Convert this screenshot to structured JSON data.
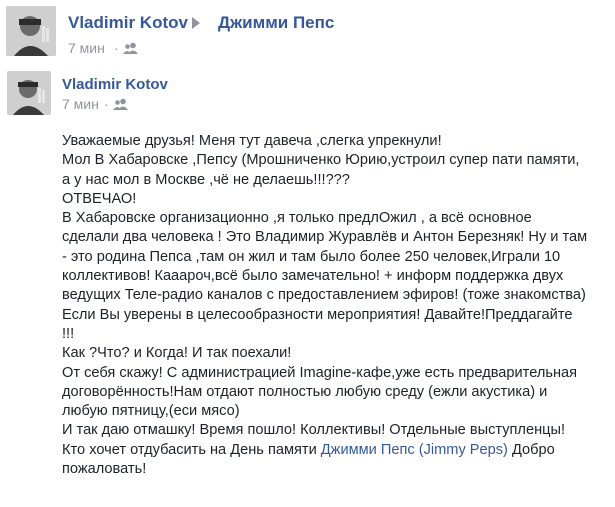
{
  "header": {
    "author": "Vladimir Kotov",
    "group": "Джимми Пепс",
    "time": "7 мин",
    "separator": "·"
  },
  "post": {
    "author": "Vladimir Kotov",
    "time": "7 мин",
    "separator": "·",
    "lines": [
      "Уважаемые друзья! Меня тут давеча ,слегка упрекнули!",
      "Мол В Хабаровске ,Пепсу (Мрошниченко Юрию,устроил супер пати памяти,",
      "а у нас мол в Москве ,чё не делаешь!!!???",
      "ОТВЕЧАО!",
      "В Хабаровске организационно ,я только предлОжил , а всё основное",
      "сделали два человека ! Это Владимир Журавлёв и Антон Березняк! Ну и там",
      "- это родина Пепса ,там он жил и там было более 250 человек,Играли 10",
      "коллективов! Кааароч,всё было замечательно! + информ поддержка двух",
      "ведущих Теле-радио каналов с предоставлением эфиров! (тоже знакомства)",
      "Если Вы уверены в целесообразности мероприятия! Давайте!Преддагайте",
      "!!!",
      "Как ?Что? и Когда! И так поехали!",
      "От себя скажу! С администрацией Imagine-кафе,уже есть предварительная",
      "договорённость!Нам отдают полностью любую среду (ежли акустика) и",
      "любую пятницу,(еси мясо)",
      "И так даю отмашку! Время пошло! Коллективы! Отдельные выступленцы!"
    ],
    "last_line_before": "Кто хочет отдубасить на День памяти ",
    "mention": "Джимми Пепс (Jimmy Peps)",
    "last_line_after": " Добро",
    "final_line": "пожаловать!"
  },
  "colors": {
    "link": "#365899",
    "meta": "#90949c",
    "text": "#1d2129"
  },
  "icons": {
    "privacy": "friends-icon"
  }
}
